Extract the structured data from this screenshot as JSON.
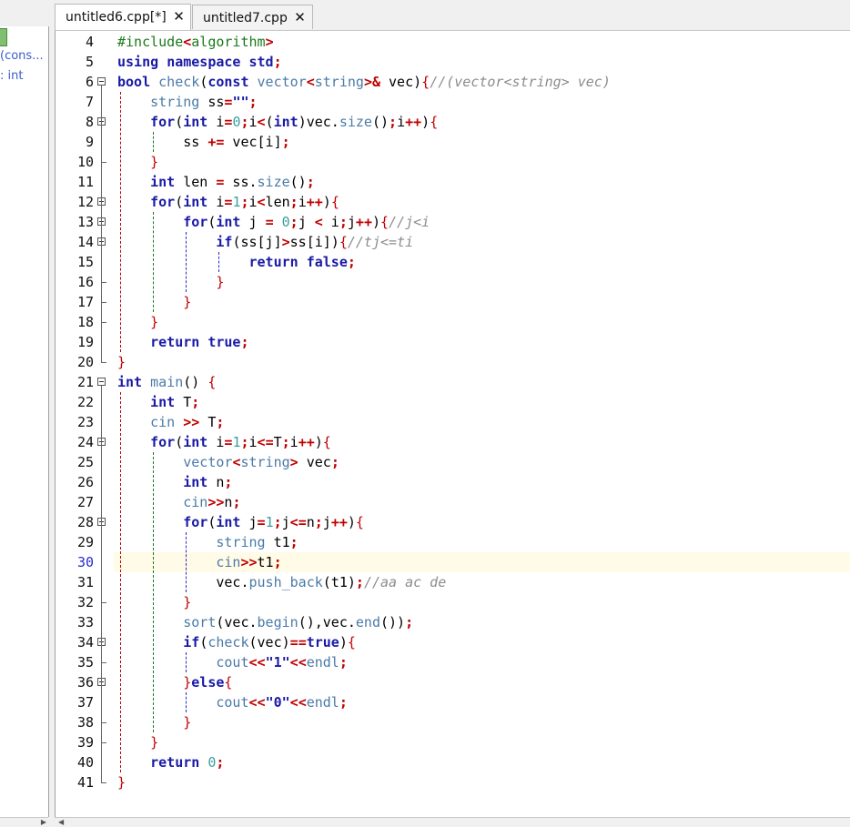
{
  "tabs": [
    {
      "label": "untitled6.cpp[*]",
      "active": true
    },
    {
      "label": "untitled7.cpp",
      "active": false
    }
  ],
  "left_panel": {
    "items": [
      "(cons...",
      ": int"
    ]
  },
  "editor": {
    "current_line": 30,
    "lines": [
      {
        "n": 4,
        "text": "#include<algorithm>"
      },
      {
        "n": 5,
        "text": "using namespace std;"
      },
      {
        "n": 6,
        "text": "bool check(const vector<string>& vec){//(vector<string> vec)"
      },
      {
        "n": 7,
        "text": "    string ss=\"\";"
      },
      {
        "n": 8,
        "text": "    for(int i=0;i<(int)vec.size();i++){"
      },
      {
        "n": 9,
        "text": "        ss += vec[i];"
      },
      {
        "n": 10,
        "text": "    }"
      },
      {
        "n": 11,
        "text": "    int len = ss.size();"
      },
      {
        "n": 12,
        "text": "    for(int i=1;i<len;i++){"
      },
      {
        "n": 13,
        "text": "        for(int j = 0;j < i;j++){//j<i"
      },
      {
        "n": 14,
        "text": "            if(ss[j]>ss[i]){//tj<=ti"
      },
      {
        "n": 15,
        "text": "                return false;"
      },
      {
        "n": 16,
        "text": "            }"
      },
      {
        "n": 17,
        "text": "        }"
      },
      {
        "n": 18,
        "text": "    }"
      },
      {
        "n": 19,
        "text": "    return true;"
      },
      {
        "n": 20,
        "text": "}"
      },
      {
        "n": 21,
        "text": "int main() {"
      },
      {
        "n": 22,
        "text": "    int T;"
      },
      {
        "n": 23,
        "text": "    cin >> T;"
      },
      {
        "n": 24,
        "text": "    for(int i=1;i<=T;i++){"
      },
      {
        "n": 25,
        "text": "        vector<string> vec;"
      },
      {
        "n": 26,
        "text": "        int n;"
      },
      {
        "n": 27,
        "text": "        cin>>n;"
      },
      {
        "n": 28,
        "text": "        for(int j=1;j<=n;j++){"
      },
      {
        "n": 29,
        "text": "            string t1;"
      },
      {
        "n": 30,
        "text": "            cin>>t1;"
      },
      {
        "n": 31,
        "text": "            vec.push_back(t1);//aa ac de"
      },
      {
        "n": 32,
        "text": "        }"
      },
      {
        "n": 33,
        "text": "        sort(vec.begin(),vec.end());"
      },
      {
        "n": 34,
        "text": "        if(check(vec)==true){"
      },
      {
        "n": 35,
        "text": "            cout<<\"1\"<<endl;"
      },
      {
        "n": 36,
        "text": "        }else{"
      },
      {
        "n": 37,
        "text": "            cout<<\"0\"<<endl;"
      },
      {
        "n": 38,
        "text": "        }"
      },
      {
        "n": 39,
        "text": "    }"
      },
      {
        "n": 40,
        "text": "    return 0;"
      },
      {
        "n": 41,
        "text": "}"
      }
    ]
  },
  "colors": {
    "keyword": "#1a1aa6",
    "operator": "#c00000",
    "number": "#3aa0a0",
    "comment": "#8c8c8c",
    "current_line_bg": "#fffbe6",
    "current_line_number": "#2a2acc"
  }
}
